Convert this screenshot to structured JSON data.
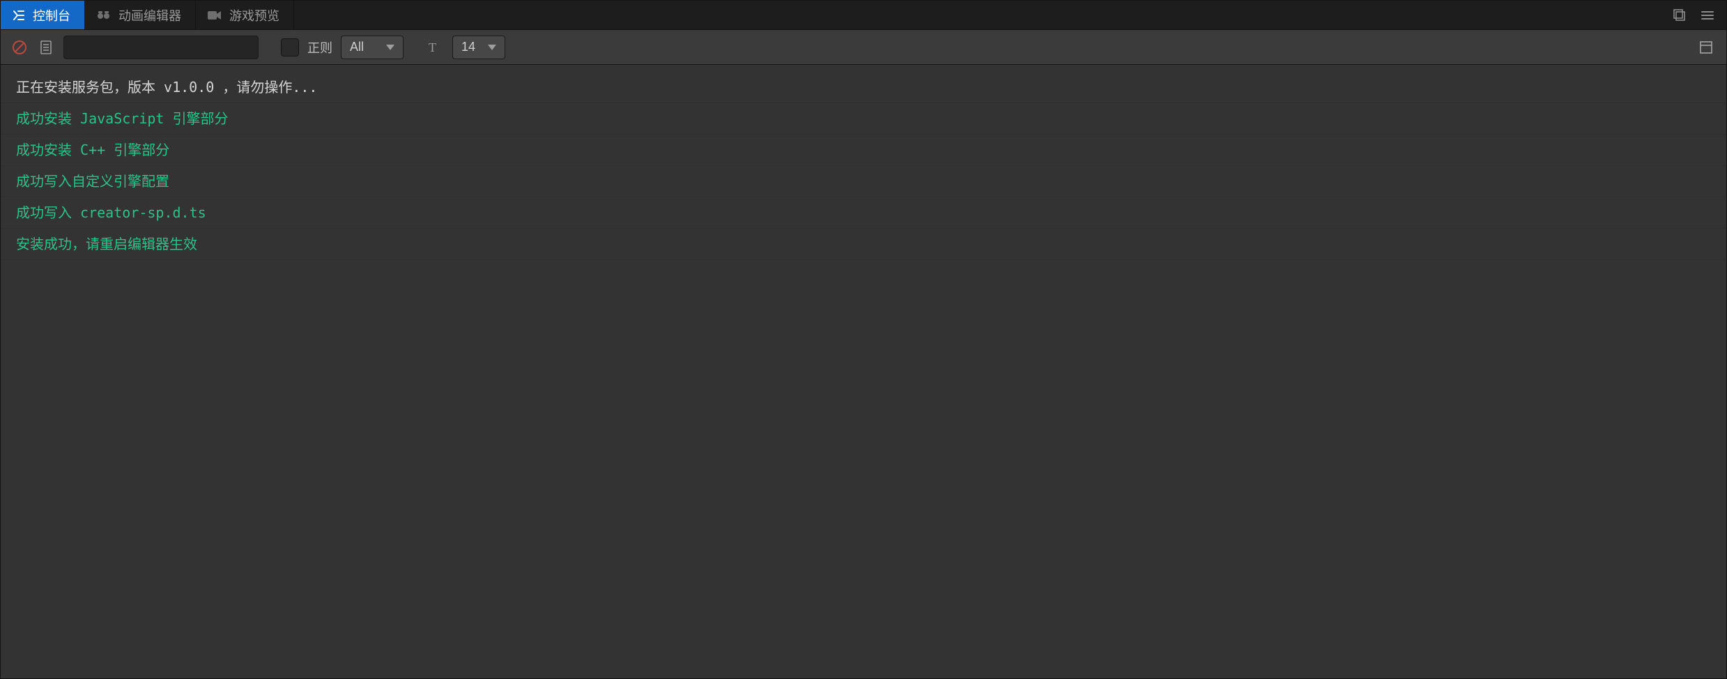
{
  "tabs": [
    {
      "label": "控制台",
      "icon": "console",
      "active": true
    },
    {
      "label": "动画编辑器",
      "icon": "animation",
      "active": false
    },
    {
      "label": "游戏预览",
      "icon": "preview",
      "active": false
    }
  ],
  "window": {
    "popout_tooltip": "弹出",
    "menu_tooltip": "菜单"
  },
  "toolbar": {
    "clear_tooltip": "清空",
    "copy_tooltip": "复制",
    "search_value": "",
    "search_placeholder": "",
    "regex_checked": false,
    "regex_label": "正则",
    "level_select": "All",
    "font_icon_tooltip": "字体大小",
    "font_size_select": "14",
    "collapse_tooltip": "折叠"
  },
  "logs": [
    {
      "type": "info",
      "text": "正在安装服务包，版本 v1.0.0 ，请勿操作..."
    },
    {
      "type": "success",
      "text": "成功安装 JavaScript 引擎部分"
    },
    {
      "type": "success",
      "text": "成功安装 C++ 引擎部分"
    },
    {
      "type": "success",
      "text": "成功写入自定义引擎配置"
    },
    {
      "type": "success",
      "text": "成功写入 creator-sp.d.ts"
    },
    {
      "type": "success",
      "text": "安装成功，请重启编辑器生效"
    }
  ]
}
